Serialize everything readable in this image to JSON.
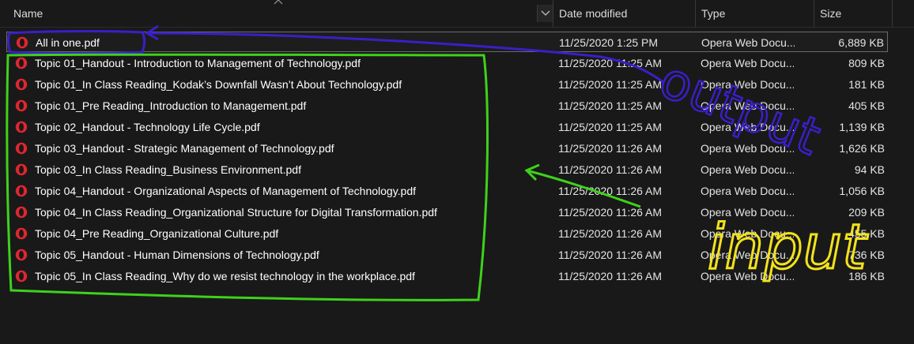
{
  "columns": {
    "name": "Name",
    "date": "Date modified",
    "type": "Type",
    "size": "Size"
  },
  "files": [
    {
      "name": "All in one.pdf",
      "date": "11/25/2020 1:25 PM",
      "type": "Opera Web Docu...",
      "size": "6,889 KB",
      "selected": true
    },
    {
      "name": "Topic 01_Handout - Introduction to Management of Technology.pdf",
      "date": "11/25/2020 11:25 AM",
      "type": "Opera Web Docu...",
      "size": "809 KB"
    },
    {
      "name": "Topic 01_In Class Reading_Kodak’s Downfall Wasn’t About Technology.pdf",
      "date": "11/25/2020 11:25 AM",
      "type": "Opera Web Docu...",
      "size": "181 KB"
    },
    {
      "name": "Topic 01_Pre Reading_Introduction to Management.pdf",
      "date": "11/25/2020 11:25 AM",
      "type": "Opera Web Docu...",
      "size": "405 KB"
    },
    {
      "name": "Topic 02_Handout - Technology Life Cycle.pdf",
      "date": "11/25/2020 11:25 AM",
      "type": "Opera Web Docu...",
      "size": "1,139 KB"
    },
    {
      "name": "Topic 03_Handout - Strategic Management of Technology.pdf",
      "date": "11/25/2020 11:26 AM",
      "type": "Opera Web Docu...",
      "size": "1,626 KB"
    },
    {
      "name": "Topic 03_In Class Reading_Business Environment.pdf",
      "date": "11/25/2020 11:26 AM",
      "type": "Opera Web Docu...",
      "size": "94 KB"
    },
    {
      "name": "Topic 04_Handout - Organizational Aspects of Management of Technology.pdf",
      "date": "11/25/2020 11:26 AM",
      "type": "Opera Web Docu...",
      "size": "1,056 KB"
    },
    {
      "name": "Topic 04_In Class Reading_Organizational Structure for Digital Transformation.pdf",
      "date": "11/25/2020 11:26 AM",
      "type": "Opera Web Docu...",
      "size": "209 KB"
    },
    {
      "name": "Topic 04_Pre Reading_Organizational Culture.pdf",
      "date": "11/25/2020 11:26 AM",
      "type": "Opera Web Docu...",
      "size": "455 KB"
    },
    {
      "name": "Topic 05_Handout - Human Dimensions of Technology.pdf",
      "date": "11/25/2020 11:26 AM",
      "type": "Opera Web Docu...",
      "size": "736 KB"
    },
    {
      "name": "Topic 05_In Class Reading_Why do we resist technology in the workplace.pdf",
      "date": "11/25/2020 11:26 AM",
      "type": "Opera Web Docu...",
      "size": "186 KB"
    }
  ],
  "file_icon": "opera-icon",
  "annotations": {
    "output_label": "output",
    "input_label": "input",
    "output_color": "#3a1fc8",
    "input_box_color": "#3fd11c",
    "input_label_color": "#f2e21c"
  },
  "colors": {
    "background": "#191919",
    "opera_red": "#e0262f"
  }
}
